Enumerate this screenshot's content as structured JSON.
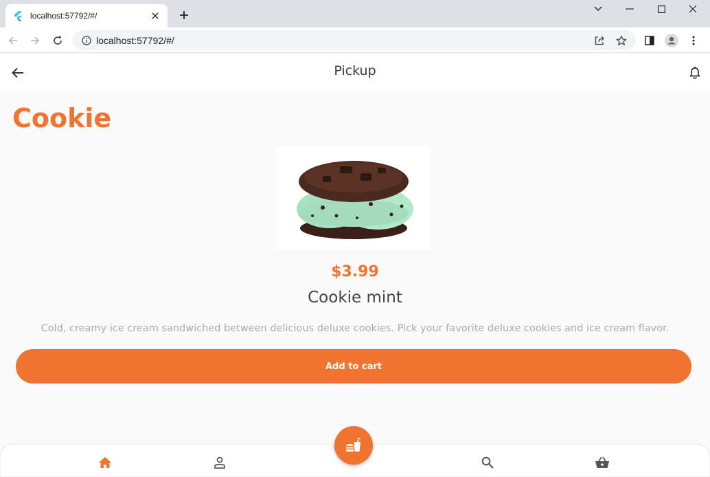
{
  "browser": {
    "tab_title": "localhost:57792/#/",
    "url": "localhost:57792/#/"
  },
  "appbar": {
    "title": "Pickup"
  },
  "product": {
    "category": "Cookie",
    "price": "$3.99",
    "name": "Cookie mint",
    "description": "Cold, creamy ice cream sandwiched between delicious deluxe cookies. Pick your favorite deluxe cookies and ice cream flavor.",
    "add_label": "Add to cart"
  },
  "nav": {
    "items": [
      "home-icon",
      "person-icon",
      "search-icon",
      "basket-icon"
    ],
    "fab_icon": "fastfood-icon",
    "active": "home-icon"
  },
  "colors": {
    "accent": "#f07330",
    "inactive": "#555555"
  }
}
